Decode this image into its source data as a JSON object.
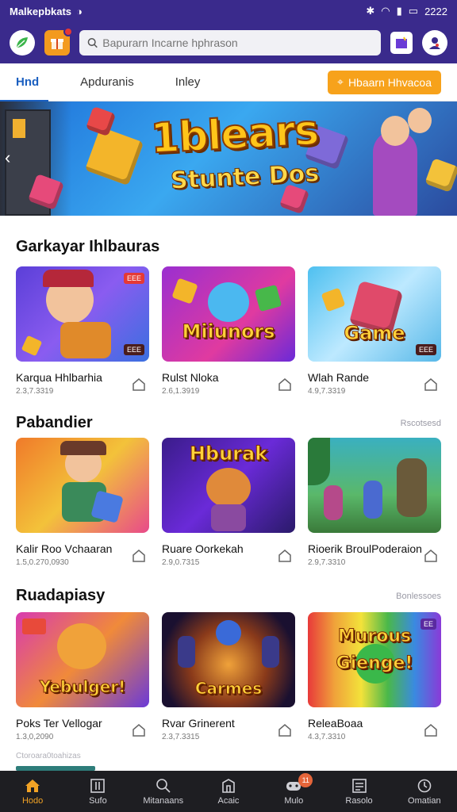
{
  "status_bar": {
    "carrier": "Malkepbkats",
    "time": "2222"
  },
  "header": {
    "search_placeholder": "Bapurarn Incarne hphrason"
  },
  "tabs": [
    {
      "label": "Hnd",
      "active": true
    },
    {
      "label": "Apduranis",
      "active": false
    },
    {
      "label": "Inley",
      "active": false
    }
  ],
  "promo_button": {
    "label": "Hbaarn Hhvacoa"
  },
  "banner": {
    "title": "1blears",
    "subtitle": "Stunte Dos"
  },
  "sections": [
    {
      "title": "Garkayar Ihlbauras",
      "more": "",
      "cards": [
        {
          "name": "Karqua Hhlbarhia",
          "meta": "2.3,7.3319",
          "thumb_text": "",
          "chip": "ЕЕЕ",
          "chip2": "ЕЕЕ"
        },
        {
          "name": "Rulst Nloka",
          "meta": "2.6,1.3919",
          "thumb_text": "Miiunors",
          "chip": "",
          "chip2": ""
        },
        {
          "name": "Wlah Rande",
          "meta": "4.9,7.3319",
          "thumb_text": "Game",
          "chip": "",
          "chip2": "ЕЕЕ"
        }
      ]
    },
    {
      "title": "Pabandier",
      "more": "Rscotsesd",
      "cards": [
        {
          "name": "Kalir Roo Vchaaran",
          "meta": "1.5,0.270,0930",
          "thumb_text": "",
          "chip": "",
          "chip2": ""
        },
        {
          "name": "Ruare Oorkekah",
          "meta": "2.9,0.7315",
          "thumb_text": "Hburak",
          "chip": "",
          "chip2": ""
        },
        {
          "name": "Rioerik BroulPoderaion",
          "meta": "2.9,7.3310",
          "thumb_text": "",
          "chip": "",
          "chip2": ""
        }
      ]
    },
    {
      "title": "Ruadapiasy",
      "more": "Bonlessoes",
      "cards": [
        {
          "name": "Poks Ter Vellogar",
          "meta": "1.3,0,2090",
          "thumb_text": "Yebulger!",
          "chip": "",
          "chip2": ""
        },
        {
          "name": "Rvar Grinerent",
          "meta": "2.3,7.3315",
          "thumb_text": "Carmes",
          "chip": "",
          "chip2": ""
        },
        {
          "name": "ReleaBoaa",
          "meta": "4.3,7.3310",
          "thumb_text": "Murous Gienge!",
          "chip": "ЕЕ",
          "chip2": ""
        }
      ]
    }
  ],
  "footer_hint": "Ctoroara0toahizas",
  "bottom_nav": [
    {
      "label": "Hodo",
      "icon": "home-icon",
      "active": true,
      "badge": ""
    },
    {
      "label": "Sufo",
      "icon": "grid-icon",
      "active": false,
      "badge": ""
    },
    {
      "label": "Mitanaans",
      "icon": "search-icon",
      "active": false,
      "badge": ""
    },
    {
      "label": "Acaic",
      "icon": "building-icon",
      "active": false,
      "badge": ""
    },
    {
      "label": "Mulo",
      "icon": "gamepad-icon",
      "active": false,
      "badge": "11"
    },
    {
      "label": "Rasolo",
      "icon": "list-icon",
      "active": false,
      "badge": ""
    },
    {
      "label": "Omatian",
      "icon": "clock-icon",
      "active": false,
      "badge": ""
    }
  ],
  "colors": {
    "header_bg": "#3a2a8c",
    "accent": "#f7a21b",
    "tab_active": "#1a5fc0",
    "nav_bg": "#1e1e22"
  }
}
